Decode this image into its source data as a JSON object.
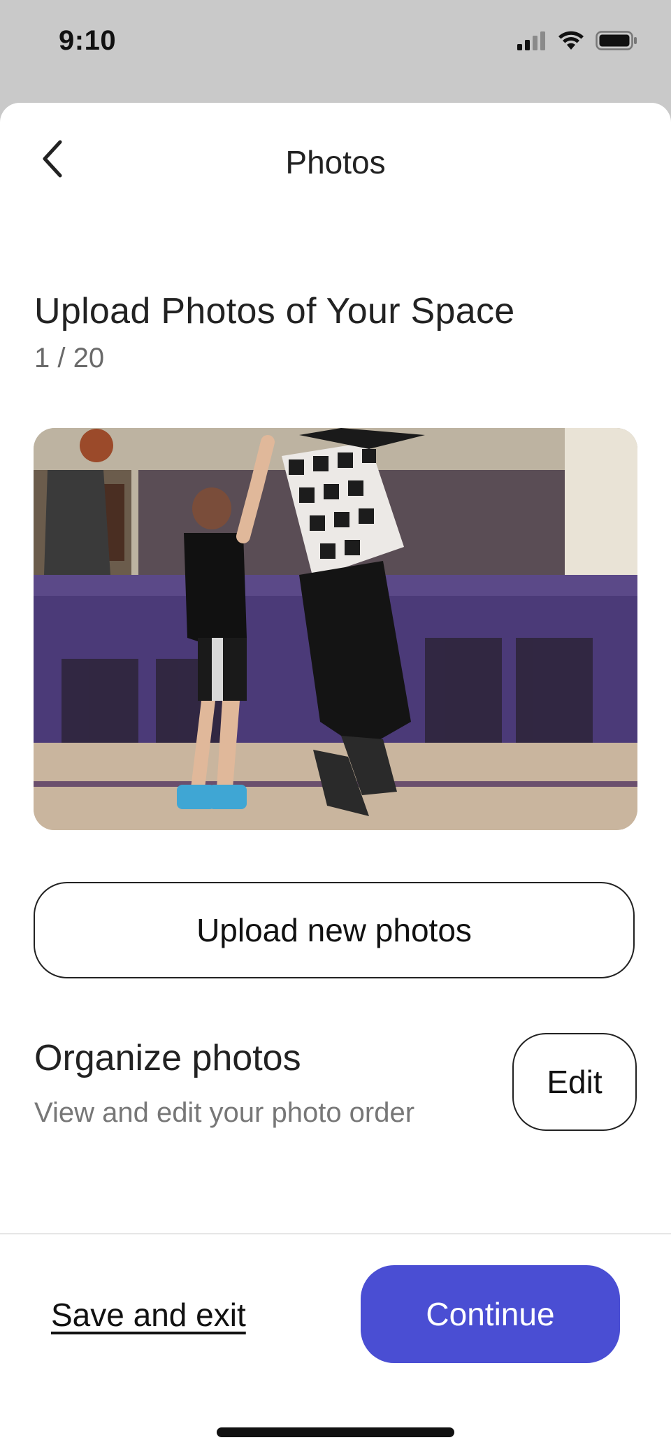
{
  "status_bar": {
    "time": "9:10",
    "icons": [
      "cellular-signal-icon",
      "wifi-icon",
      "battery-icon"
    ]
  },
  "nav": {
    "back_icon": "chevron-left-icon",
    "title": "Photos"
  },
  "upload_section": {
    "title": "Upload Photos of Your Space",
    "count": "1 / 20",
    "upload_button_label": "Upload new photos"
  },
  "organize_section": {
    "title": "Organize photos",
    "subtitle": "View and edit your photo order",
    "edit_button_label": "Edit"
  },
  "footer": {
    "save_exit_label": "Save and exit",
    "continue_label": "Continue"
  },
  "colors": {
    "accent": "#4a4ed3",
    "status_bar_bg": "#c9c9c9",
    "text_primary": "#222222",
    "text_secondary": "#777777"
  }
}
